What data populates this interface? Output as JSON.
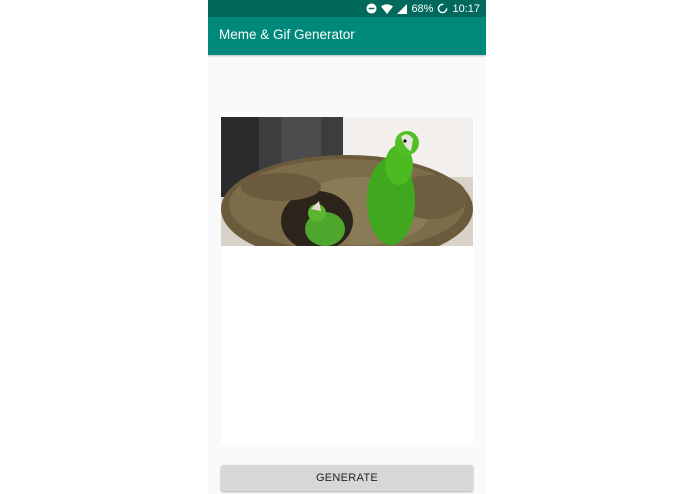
{
  "status_bar": {
    "battery_percent": "68%",
    "time": "10:17",
    "icons": [
      "do-not-disturb-icon",
      "wifi-icon",
      "signal-icon",
      "battery-charging-icon"
    ]
  },
  "app_bar": {
    "title": "Meme & Gif Generator"
  },
  "preview": {
    "image": "parrots-in-nest-gif"
  },
  "generate_button": {
    "label": "GENERATE"
  },
  "colors": {
    "status_bar": "#00695c",
    "app_bar": "#00897b",
    "background": "#fafafa",
    "button": "#d6d7d7"
  }
}
